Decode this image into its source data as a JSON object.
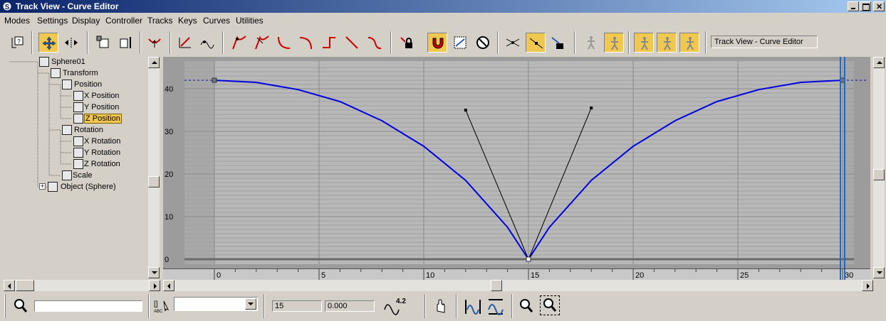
{
  "window": {
    "title": "Track View - Curve Editor"
  },
  "menu": [
    "Modes",
    "Settings",
    "Display",
    "Controller",
    "Tracks",
    "Keys",
    "Curves",
    "Utilities"
  ],
  "toolbar": {
    "name_field": "Track View - Curve Editor"
  },
  "tree": [
    {
      "label": "Sphere01",
      "icon": "sphere-icon"
    },
    {
      "label": "Transform",
      "icon": "transform-icon"
    },
    {
      "label": "Position",
      "icon": "position-icon"
    },
    {
      "label": "X Position",
      "icon": "curve-track-icon"
    },
    {
      "label": "Y Position",
      "icon": "curve-track-icon"
    },
    {
      "label": "Z Position",
      "icon": "curve-track-icon",
      "selected": true
    },
    {
      "label": "Rotation",
      "icon": "rotation-icon"
    },
    {
      "label": "X Rotation",
      "icon": "curve-track-icon"
    },
    {
      "label": "Y Rotation",
      "icon": "curve-track-icon"
    },
    {
      "label": "Z Rotation",
      "icon": "curve-track-icon"
    },
    {
      "label": "Scale",
      "icon": "scale-icon"
    },
    {
      "label": "Object (Sphere)",
      "icon": "object-icon"
    }
  ],
  "graph": {
    "y_ticks": [
      "40",
      "30",
      "20",
      "10",
      "0"
    ],
    "x_ticks": [
      "0",
      "5",
      "10",
      "15",
      "20",
      "25",
      "30"
    ],
    "curve_color": "#0000e0"
  },
  "chart_data": {
    "type": "line",
    "title": "",
    "xlabel": "",
    "ylabel": "",
    "xlim": [
      -0.5,
      31
    ],
    "ylim": [
      -1,
      44
    ],
    "series": [
      {
        "x": [
          0,
          2,
          4,
          6,
          8,
          10,
          12,
          14,
          15,
          16,
          18,
          20,
          22,
          24,
          26,
          28,
          30
        ],
        "values": [
          42,
          41.5,
          39.8,
          37,
          32.5,
          26.5,
          18.5,
          7.5,
          0,
          7.5,
          18.5,
          26.5,
          32.5,
          37,
          39.8,
          41.5,
          42
        ]
      }
    ],
    "keys": [
      {
        "x": 0,
        "y": 42
      },
      {
        "x": 15,
        "y": 0
      },
      {
        "x": 30,
        "y": 42
      }
    ],
    "tangent_handles": [
      {
        "x": 12,
        "y": 35
      },
      {
        "x": 18,
        "y": 35.5
      }
    ],
    "current_frame": 30
  },
  "bottom": {
    "frame_value": "15",
    "value_field": "0.000",
    "numeric_label": "4.2"
  }
}
